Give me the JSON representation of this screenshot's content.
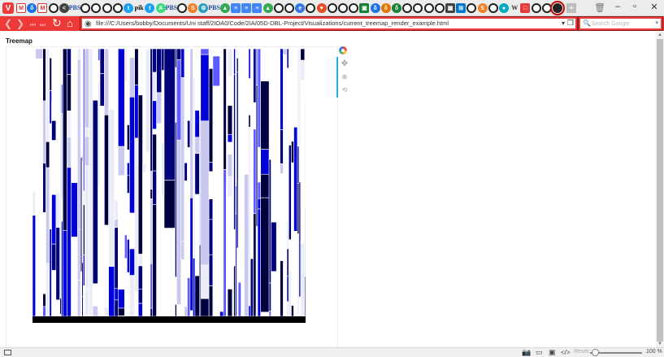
{
  "tabs": [
    {
      "name": "gmail-tab-icon",
      "label": "M",
      "color": "#d93025",
      "kind": "mail"
    },
    {
      "name": "site-tab-icon",
      "label": "δ",
      "color": "#1a73e8",
      "kind": ""
    },
    {
      "name": "gmail-tab-icon",
      "label": "M",
      "color": "#d93025",
      "kind": "mail"
    },
    {
      "name": "github-tab-icon",
      "label": "",
      "color": "#222222",
      "kind": "gh"
    },
    {
      "name": "share-tab-icon",
      "label": "<",
      "color": "#444444",
      "kind": ""
    },
    {
      "name": "pbs-tab-icon",
      "label": "PBS",
      "color": "#1f4c9e",
      "kind": "word"
    },
    {
      "name": "github-tab-icon",
      "label": "",
      "color": "#222222",
      "kind": "gh"
    },
    {
      "name": "github-tab-icon",
      "label": "",
      "color": "#222222",
      "kind": "gh"
    },
    {
      "name": "github-tab-icon",
      "label": "",
      "color": "#222222",
      "kind": "gh"
    },
    {
      "name": "github-tab-icon",
      "label": "",
      "color": "#222222",
      "kind": "gh"
    },
    {
      "name": "twitter-tab-icon",
      "label": "t",
      "color": "#1da1f2",
      "kind": ""
    },
    {
      "name": "pik-tab-icon",
      "label": "pik",
      "color": "#111111",
      "kind": "word"
    },
    {
      "name": "twitter-tab-icon",
      "label": "t",
      "color": "#1da1f2",
      "kind": ""
    },
    {
      "name": "android-tab-icon",
      "label": "A",
      "color": "#3ddc84",
      "kind": ""
    },
    {
      "name": "pbs-tab-icon",
      "label": "PBS",
      "color": "#1f4c9e",
      "kind": "word"
    },
    {
      "name": "github-tab-icon",
      "label": "",
      "color": "#222222",
      "kind": "gh"
    },
    {
      "name": "stackoverflow-tab-icon",
      "label": "S",
      "color": "#f48024",
      "kind": ""
    },
    {
      "name": "settings-tab-icon",
      "label": "⚙",
      "color": "#2e9fbe",
      "kind": ""
    },
    {
      "name": "pbs-tab-icon",
      "label": "PBS",
      "color": "#1f4c9e",
      "kind": "word"
    },
    {
      "name": "drive-tab-icon",
      "label": "▲",
      "color": "#34a853",
      "kind": ""
    },
    {
      "name": "docs-tab-icon",
      "label": "≡",
      "color": "#4285f4",
      "kind": "sq"
    },
    {
      "name": "docs-tab-icon",
      "label": "≡",
      "color": "#4285f4",
      "kind": "sq"
    },
    {
      "name": "docs-tab-icon",
      "label": "≡",
      "color": "#4285f4",
      "kind": "sq"
    },
    {
      "name": "drive-tab-icon",
      "label": "▲",
      "color": "#34a853",
      "kind": ""
    },
    {
      "name": "github-tab-icon",
      "label": "",
      "color": "#222222",
      "kind": "gh"
    },
    {
      "name": "github-tab-icon",
      "label": "",
      "color": "#222222",
      "kind": "gh"
    },
    {
      "name": "site-tab-icon",
      "label": "e",
      "color": "#3578e5",
      "kind": ""
    },
    {
      "name": "github-tab-icon",
      "label": "",
      "color": "#222222",
      "kind": "gh"
    },
    {
      "name": "shield-tab-icon",
      "label": "♥",
      "color": "#e34c26",
      "kind": ""
    },
    {
      "name": "github-tab-icon",
      "label": "",
      "color": "#222222",
      "kind": "gh"
    },
    {
      "name": "github-tab-icon",
      "label": "",
      "color": "#222222",
      "kind": "gh"
    },
    {
      "name": "github-tab-icon",
      "label": "",
      "color": "#222222",
      "kind": "gh"
    },
    {
      "name": "sheet-tab-icon",
      "label": "▣",
      "color": "#188038",
      "kind": "sq"
    },
    {
      "name": "site-tab-icon",
      "label": "δ",
      "color": "#1a73e8",
      "kind": ""
    },
    {
      "name": "site-tab-icon",
      "label": "δ",
      "color": "#e37400",
      "kind": ""
    },
    {
      "name": "site-tab-icon",
      "label": "δ",
      "color": "#188038",
      "kind": ""
    },
    {
      "name": "github-tab-icon",
      "label": "",
      "color": "#222222",
      "kind": "gh"
    },
    {
      "name": "github-tab-icon",
      "label": "",
      "color": "#222222",
      "kind": "gh"
    },
    {
      "name": "github-tab-icon",
      "label": "",
      "color": "#222222",
      "kind": "gh"
    },
    {
      "name": "github-tab-icon",
      "label": "",
      "color": "#222222",
      "kind": "gh"
    },
    {
      "name": "calendar-tab-icon",
      "label": "▦",
      "color": "#444444",
      "kind": "sq"
    },
    {
      "name": "windows-tab-icon",
      "label": "⊞",
      "color": "#0078d4",
      "kind": "sq"
    },
    {
      "name": "github-tab-icon",
      "label": "",
      "color": "#222222",
      "kind": "gh"
    },
    {
      "name": "stackoverflow-tab-icon",
      "label": "S",
      "color": "#f48024",
      "kind": ""
    },
    {
      "name": "github-tab-icon",
      "label": "",
      "color": "#222222",
      "kind": "gh"
    },
    {
      "name": "site-tab-icon",
      "label": "●",
      "color": "#00a9c5",
      "kind": ""
    },
    {
      "name": "wikipedia-tab-icon",
      "label": "W",
      "color": "#333333",
      "kind": "word"
    },
    {
      "name": "site-tab-icon",
      "label": "□",
      "color": "#e33c3c",
      "kind": "sq"
    },
    {
      "name": "github-tab-icon",
      "label": "",
      "color": "#222222",
      "kind": "gh"
    },
    {
      "name": "github-tab-icon",
      "label": "",
      "color": "#222222",
      "kind": "gh"
    },
    {
      "name": "github-tab-icon",
      "label": "",
      "color": "#222222",
      "kind": "gh",
      "active": true
    }
  ],
  "address": {
    "url": "file:///C:/Users/bobby/Documents/Uni staff/2IOA0/Code/2IA/05D-DBL-Project/Visualizations/current_treemap_render_example.html",
    "search_placeholder": "Search Google"
  },
  "page": {
    "title": "Treemap"
  },
  "treemap_palette": [
    "#000040",
    "#00007a",
    "#0000d8",
    "#5b5bff",
    "#c9c9f0",
    "#ececf8",
    "#ffffff"
  ],
  "statusbar": {
    "reset_label": "Reset",
    "zoom": "100 %",
    "zoom_level": 0.1
  }
}
